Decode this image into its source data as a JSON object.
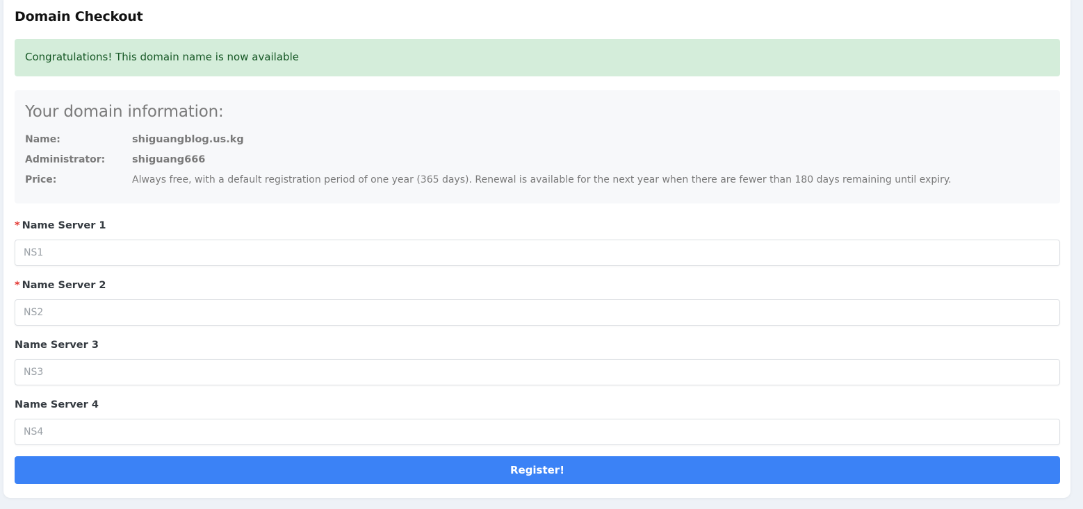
{
  "page": {
    "title": "Domain Checkout"
  },
  "alert": {
    "message": "Congratulations! This domain name is now available"
  },
  "domain_info": {
    "heading": "Your domain information:",
    "rows": [
      {
        "label": "Name:",
        "value": "shiguangblog.us.kg"
      },
      {
        "label": "Administrator:",
        "value": "shiguang666"
      },
      {
        "label": "Price:",
        "value": "Always free, with a default registration period of one year (365 days). Renewal is available for the next year when there are fewer than 180 days remaining until expiry."
      }
    ]
  },
  "name_servers": [
    {
      "label": "Name Server 1",
      "required": true,
      "required_mark": "*",
      "placeholder": "NS1",
      "value": ""
    },
    {
      "label": "Name Server 2",
      "required": true,
      "required_mark": "*",
      "placeholder": "NS2",
      "value": ""
    },
    {
      "label": "Name Server 3",
      "required": false,
      "placeholder": "NS3",
      "value": ""
    },
    {
      "label": "Name Server 4",
      "required": false,
      "placeholder": "NS4",
      "value": ""
    }
  ],
  "actions": {
    "register_label": "Register!"
  },
  "colors": {
    "alert_bg": "#d4edda",
    "alert_text": "#155724",
    "primary_button": "#3b82f6",
    "required_mark": "#e3342f"
  }
}
